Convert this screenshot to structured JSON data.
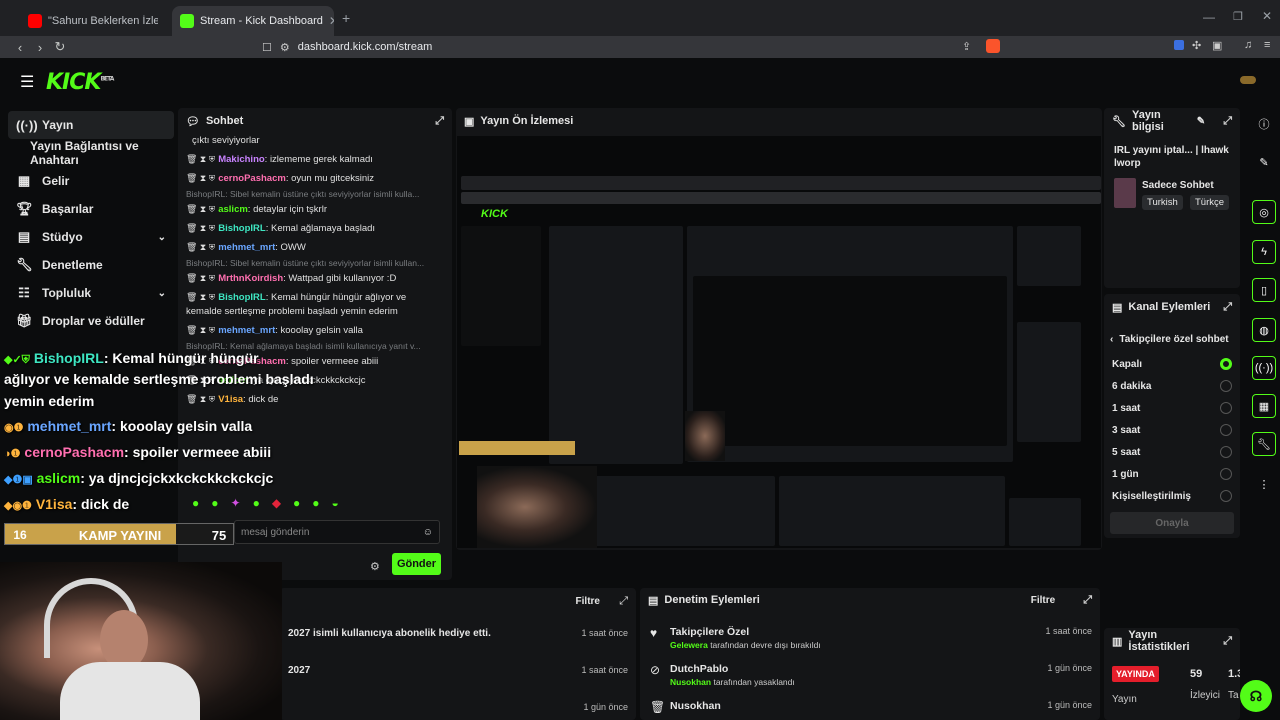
{
  "browser": {
    "tabs": [
      {
        "title": "\"Sahuru Beklerken İzlemelik Edit\" Ki"
      },
      {
        "title": "Stream - Kick Dashboard"
      }
    ],
    "url": "dashboard.kick.com/stream"
  },
  "sidebar": {
    "items": [
      {
        "label": "Yayın",
        "icon": "broadcast-icon"
      },
      {
        "label": "Yayın Bağlantısı ve Anahtarı",
        "icon": ""
      },
      {
        "label": "Gelir",
        "icon": "chart-icon"
      },
      {
        "label": "Başarılar",
        "icon": "trophy-icon"
      },
      {
        "label": "Stüdyo",
        "icon": "studio-icon"
      },
      {
        "label": "Denetleme",
        "icon": "wrench-icon"
      },
      {
        "label": "Topluluk",
        "icon": "community-icon"
      },
      {
        "label": "Droplar ve ödüller",
        "icon": "gift-icon"
      }
    ]
  },
  "chat": {
    "title": "Sohbet",
    "top_fragment": "çıktı seviyiyorlar",
    "messages": [
      {
        "user": "Makichino",
        "text": ": izlememe gerek kalmadı"
      },
      {
        "user": "cernoPashacm",
        "text": ": oyun mu gitceksiniz"
      },
      {
        "reply": "BishopIRL: Sibel kemalin üstüne çıktı seviyiyorlar isimli kulla..."
      },
      {
        "user": "aslicm",
        "text": ": detaylar için tşkrlr"
      },
      {
        "user": "BishopIRL",
        "text": ": Kemal ağlamaya başladı"
      },
      {
        "user": "mehmet_mrt",
        "text": ": OWW"
      },
      {
        "reply": "BishopIRL: Sibel kemalin üstüne çıktı seviyiyorlar isimli kullan..."
      },
      {
        "user": "MrthnKoirdish",
        "text": ": Wattpad gibi kullanıyor :D"
      },
      {
        "user": "BishopIRL",
        "text": ": Kemal hüngür hüngür ağlıyor ve kemalde sertleşme problemi başladı yemin ederim"
      },
      {
        "user": "mehmet_mrt",
        "text": ": kooolay gelsin valla"
      },
      {
        "reply": "BishopIRL: Kemal ağlamaya başladı isimli kullanıcıya yanıt v..."
      },
      {
        "user": "cernoPashacm",
        "text": ": spoiler vermeee abiii"
      },
      {
        "user": "aslicm",
        "text": ": ya djncjcjckxkckckkckckcjc"
      },
      {
        "user": "V1isa",
        "text": ": dick de"
      }
    ],
    "input_placeholder": "mesaj gönderin",
    "send_label": "Gönder"
  },
  "overlay": {
    "lines": [
      {
        "user": "BishopIRL",
        "text": ": Kemal hüngür hüngür"
      },
      {
        "user": "",
        "text": "ağlıyor ve kemalde sertleşme problemi başladı"
      },
      {
        "user": "",
        "text": "yemin ederim"
      },
      {
        "user": "mehmet_mrt",
        "text": ": kooolay gelsin valla"
      },
      {
        "user": "cernoPashacm",
        "text": ": spoiler vermeee abiii"
      },
      {
        "user": "aslicm",
        "text": ": ya djncjcjckxkckckkckckcjc"
      },
      {
        "user": "V1isa",
        "text": ": dick de"
      }
    ],
    "bar_left": "16",
    "bar_label": "KAMP YAYINI",
    "bar_right": "75",
    "bar_progress": 0.75
  },
  "preview": {
    "title": "Yayın Ön İzlemesi"
  },
  "stream_info": {
    "title": "Yayın bilgisi",
    "stream_title": "IRL yayını iptal... | lhawk lworp",
    "category": "Sadece Sohbet",
    "tags": [
      "Turkish",
      "Türkçe"
    ]
  },
  "channel_actions": {
    "title": "Kanal Eylemleri",
    "subtitle": "Takipçilere özel sohbet",
    "options": [
      {
        "label": "Kapalı",
        "selected": true
      },
      {
        "label": "6 dakika",
        "selected": false
      },
      {
        "label": "1 saat",
        "selected": false
      },
      {
        "label": "3 saat",
        "selected": false
      },
      {
        "label": "5 saat",
        "selected": false
      },
      {
        "label": "1 gün",
        "selected": false
      },
      {
        "label": "Kişiselleştirilmiş",
        "selected": false
      }
    ],
    "confirm_label": "Onayla"
  },
  "activity": {
    "filter_label": "Filtre",
    "rows": [
      {
        "text": "2027 isimli kullanıcıya abonelik hediye etti.",
        "time": "1 saat önce"
      },
      {
        "text": "2027",
        "time": "1 saat önce"
      },
      {
        "text": "",
        "time": "1 gün önce"
      }
    ]
  },
  "mod_actions": {
    "title": "Denetim Eylemleri",
    "filter_label": "Filtre",
    "rows": [
      {
        "title": "Takipçilere Özel",
        "actor": "Gelewera",
        "desc": "tarafından devre dışı bırakıldı",
        "time": "1 saat önce",
        "icon": "heart-icon"
      },
      {
        "title": "DutchPablo",
        "actor": "Nusokhan",
        "desc": "tarafından yasaklandı",
        "time": "1 gün önce",
        "icon": "ban-icon"
      },
      {
        "title": "Nusokhan",
        "actor": "",
        "desc": "",
        "time": "1 gün önce",
        "icon": "trash-icon"
      }
    ]
  },
  "stats": {
    "title": "Yayın İstatistikleri",
    "live_badge": "YAYINDA",
    "live_label": "Yayın",
    "viewers": "59",
    "viewers_label": "İzleyici",
    "third": "1.3",
    "third_label": "Ta"
  },
  "colors": {
    "accent": "#53fc18",
    "live": "#e41e2b",
    "panel": "#141517"
  }
}
